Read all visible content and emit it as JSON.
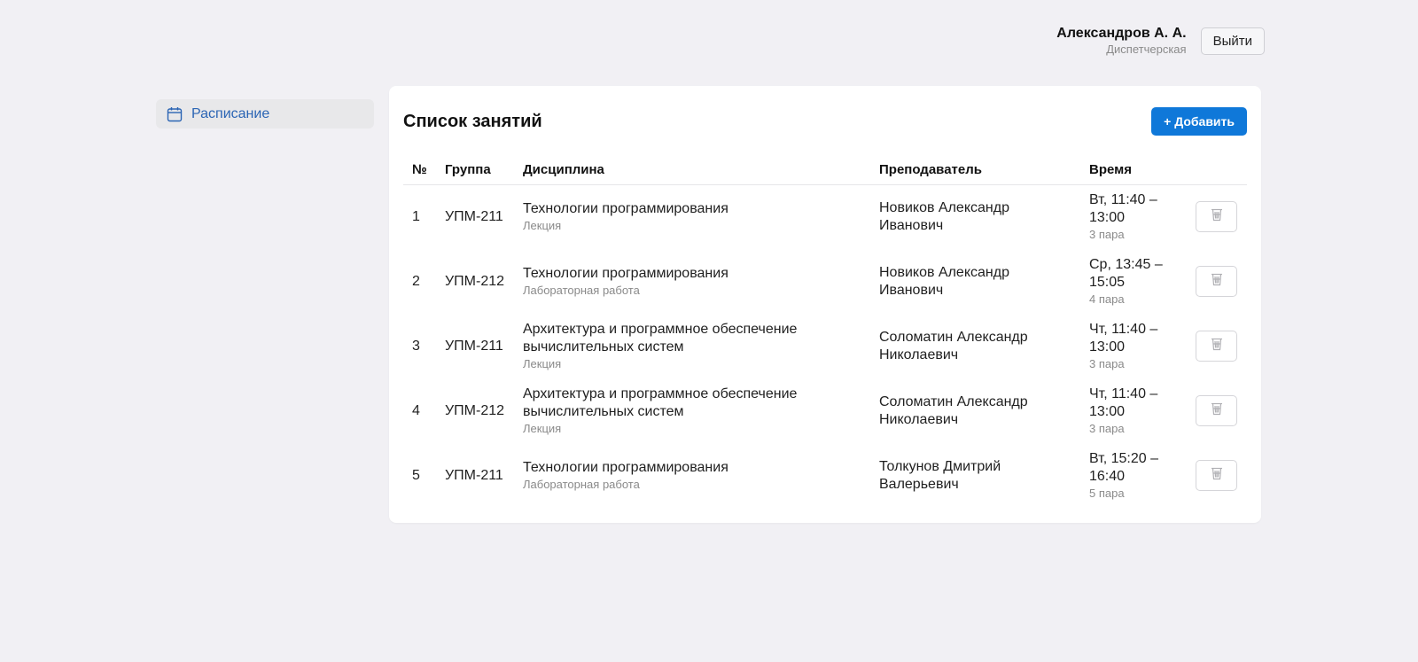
{
  "header": {
    "user_name": "Александров А. А.",
    "user_role": "Диспетчерская",
    "logout_label": "Выйти"
  },
  "sidebar": {
    "items": [
      {
        "label": "Расписание",
        "icon": "calendar-icon",
        "active": true
      }
    ]
  },
  "main": {
    "title": "Список занятий",
    "add_label": "+ Добавить",
    "columns": [
      "№",
      "Группа",
      "Дисциплина",
      "Преподаватель",
      "Время"
    ],
    "rows": [
      {
        "num": "1",
        "group": "УПМ-211",
        "discipline": "Технологии программирования",
        "type": "Лекция",
        "teacher": "Новиков Александр Иванович",
        "time": "Вт, 11:40 – 13:00",
        "pair": "3 пара"
      },
      {
        "num": "2",
        "group": "УПМ-212",
        "discipline": "Технологии программирования",
        "type": "Лабораторная работа",
        "teacher": "Новиков Александр Иванович",
        "time": "Ср, 13:45 – 15:05",
        "pair": "4 пара"
      },
      {
        "num": "3",
        "group": "УПМ-211",
        "discipline": "Архитектура и программное обеспечение вычислительных систем",
        "type": "Лекция",
        "teacher": "Соломатин Александр Николаевич",
        "time": "Чт, 11:40 – 13:00",
        "pair": "3 пара"
      },
      {
        "num": "4",
        "group": "УПМ-212",
        "discipline": "Архитектура и программное обеспечение вычислительных систем",
        "type": "Лекция",
        "teacher": "Соломатин Александр Николаевич",
        "time": "Чт, 11:40 – 13:00",
        "pair": "3 пара"
      },
      {
        "num": "5",
        "group": "УПМ-211",
        "discipline": "Технологии программирования",
        "type": "Лабораторная работа",
        "teacher": "Толкунов Дмитрий Валерьевич",
        "time": "Вт, 15:20 – 16:40",
        "pair": "5 пара"
      }
    ]
  },
  "colors": {
    "accent": "#0f78d9",
    "sidebar_active_text": "#2a64b4",
    "background": "#f1f0f4"
  }
}
